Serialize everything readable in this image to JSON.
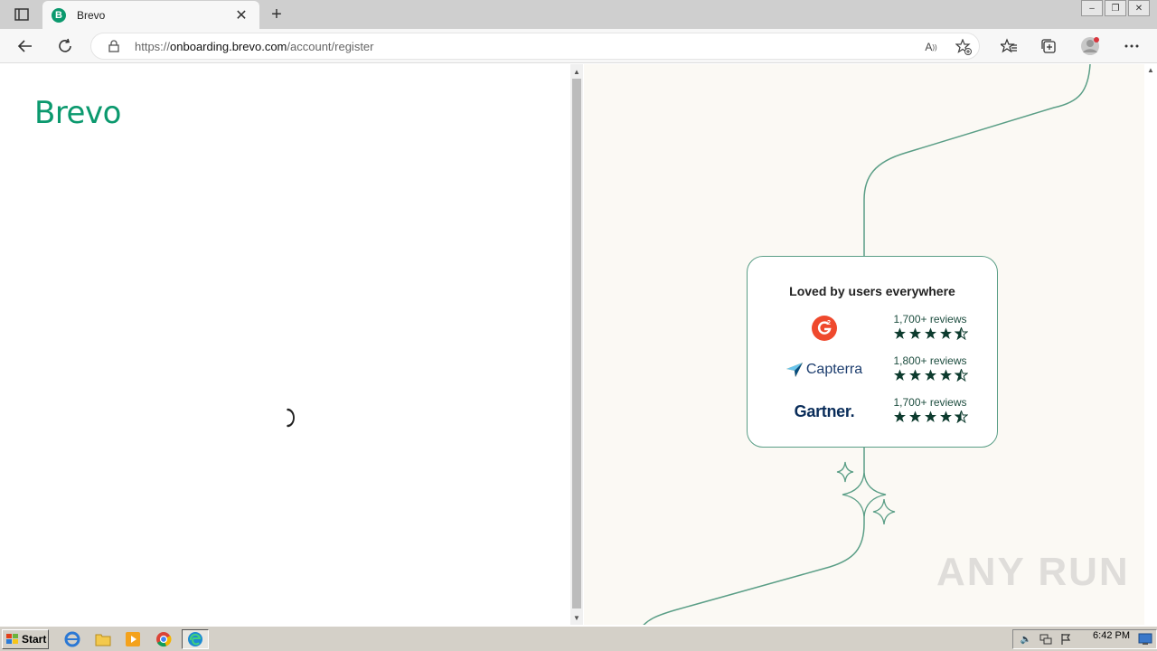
{
  "browser": {
    "tab_title": "Brevo",
    "tab_favicon_letter": "B",
    "url_prefix": "https://",
    "url_host": "onboarding.brevo.com",
    "url_path": "/account/register"
  },
  "page": {
    "logo_text": "Brevo",
    "brand_color": "#0b996e",
    "card": {
      "title": "Loved by users everywhere",
      "reviews": [
        {
          "source": "G2",
          "text": "1,700+ reviews",
          "rating": 4.5
        },
        {
          "source": "Capterra",
          "text": "1,800+ reviews",
          "rating": 4.5
        },
        {
          "source": "Gartner",
          "text": "1,700+ reviews",
          "rating": 4.5
        }
      ]
    }
  },
  "watermark": "ANY RUN",
  "taskbar": {
    "start_label": "Start",
    "clock": "6:42 PM"
  }
}
